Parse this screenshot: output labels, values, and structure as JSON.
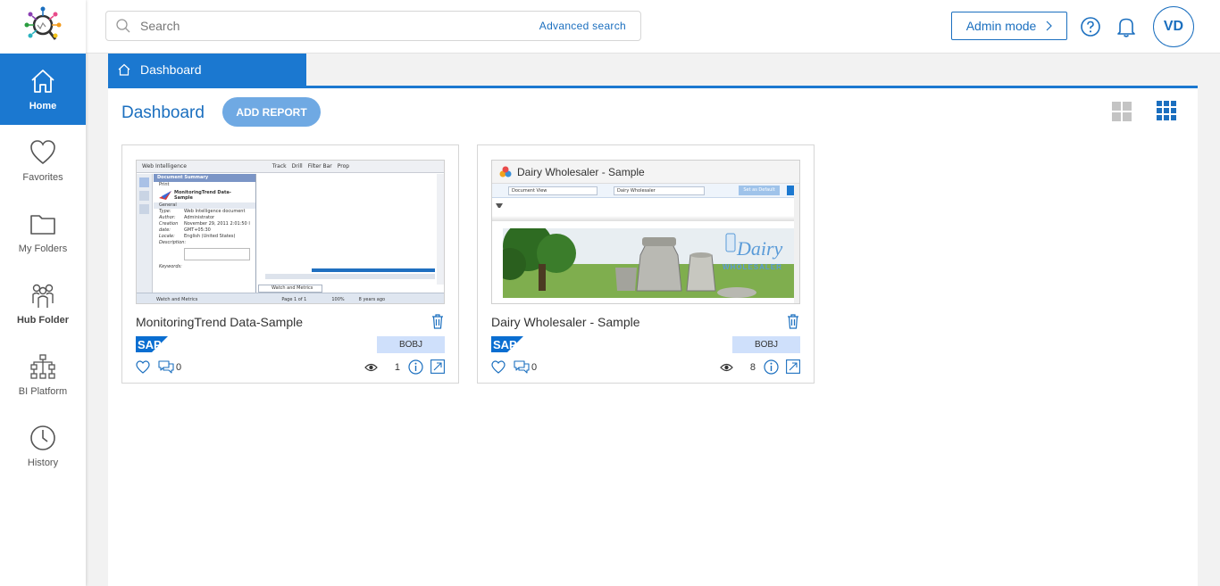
{
  "nav": {
    "items": [
      {
        "label": "Home",
        "icon": "home-icon"
      },
      {
        "label": "Favorites",
        "icon": "heart-icon"
      },
      {
        "label": "My Folders",
        "icon": "folder-icon"
      },
      {
        "label": "Hub Folder",
        "icon": "people-icon"
      },
      {
        "label": "BI Platform",
        "icon": "hierarchy-icon"
      },
      {
        "label": "History",
        "icon": "clock-icon"
      }
    ],
    "active": "Home"
  },
  "topbar": {
    "search_placeholder": "Search",
    "advanced_search": "Advanced search",
    "admin_mode": "Admin mode",
    "avatar_initials": "VD"
  },
  "tab": {
    "label": "Dashboard"
  },
  "page": {
    "title": "Dashboard",
    "add_report": "ADD REPORT"
  },
  "reports": [
    {
      "title": "MonitoringTrend Data-Sample",
      "badge": "BOBJ",
      "comments": "0",
      "views": "1",
      "thumbnail": {
        "toolbar": [
          "Web Intelligence",
          "Track",
          "Drill",
          "Filter Bar",
          "Prop"
        ],
        "panel_title": "Document Summary",
        "print": "Print",
        "doc_name": "MonitoringTrend Data-Sample",
        "section": "General",
        "rows": [
          {
            "k": "Type:",
            "v": "Web Intelligence document"
          },
          {
            "k": "Author:",
            "v": "Administrator"
          },
          {
            "k": "Creation date:",
            "v": "November 29, 2011 2:01:50 I GMT+05:30"
          },
          {
            "k": "Locale:",
            "v": "English (United States)"
          },
          {
            "k": "Description:",
            "v": ""
          },
          {
            "k": "Keywords:",
            "v": ""
          }
        ],
        "sheet_tab": "Watch and Metrics",
        "status_left": "Watch and Metrics",
        "page_info": "Page 1 of 1",
        "zoom": "100%",
        "age": "8 years ago"
      }
    },
    {
      "title": "Dairy Wholesaler - Sample",
      "badge": "BOBJ",
      "comments": "0",
      "views": "8",
      "thumbnail": {
        "heading": "Dairy Wholesaler - Sample",
        "dropdown1": "Document View",
        "dropdown2": "Dairy Wholesaler",
        "set_default": "Set as Default",
        "banner_text": "Dairy",
        "banner_sub": "WHOLESALER"
      }
    }
  ],
  "colors": {
    "accent": "#1b78d0",
    "link": "#1b6fbf",
    "badge_bg": "#cfe0fb",
    "add_button": "#6fa9e3"
  }
}
